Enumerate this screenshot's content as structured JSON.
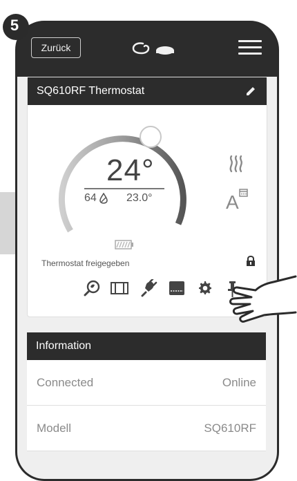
{
  "step": "5",
  "topbar": {
    "back_label": "Zurück"
  },
  "device": {
    "title": "SQ610RF Thermostat",
    "target_temperature": "24°",
    "humidity": "64",
    "current_temperature": "23.0°",
    "status": "Thermostat freigegeben"
  },
  "info": {
    "title": "Information",
    "rows": [
      {
        "label": "Connected",
        "value": "Online"
      },
      {
        "label": "Modell",
        "value": "SQ610RF"
      }
    ]
  }
}
